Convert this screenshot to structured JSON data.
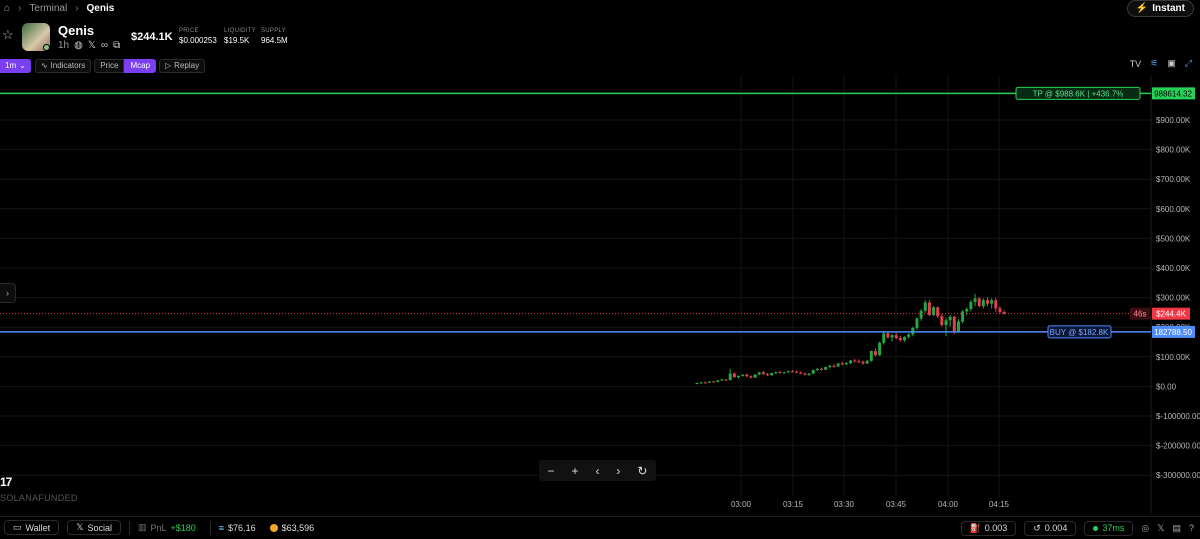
{
  "breadcrumb": {
    "home_icon": "home-icon",
    "items": [
      "Terminal",
      "Qenis"
    ]
  },
  "instant": {
    "label": "Instant",
    "icon": "lightning-icon"
  },
  "token": {
    "name": "Qenis",
    "age": "1h",
    "market_cap": "$244.1K",
    "stats": [
      {
        "label": "PRICE",
        "value": "$0.000253"
      },
      {
        "label": "LIQUIDITY",
        "value": "$19.5K"
      },
      {
        "label": "SUPPLY",
        "value": "964.5M"
      }
    ]
  },
  "toolbar": {
    "timeframe": "1m",
    "indicators": "Indicators",
    "price": "Price",
    "mcap": "Mcap",
    "replay": "Replay"
  },
  "chart_data": {
    "type": "candlestick",
    "price_axis_labels": [
      "$900.00K",
      "$800.00K",
      "$700.00K",
      "$600.00K",
      "$500.00K",
      "$400.00K",
      "$300.00K",
      "$200.00K",
      "$100.00K",
      "$0.00",
      "$-100000.00",
      "$-200000.00",
      "$-300000.00"
    ],
    "time_axis_labels": [
      "03:00",
      "03:15",
      "03:30",
      "03:45",
      "04:00",
      "04:15"
    ],
    "tp_line": {
      "label": "TP @ $988.6K | +436.7%",
      "value": 988614.32,
      "axis_label": "988614.32",
      "color": "#27d158"
    },
    "buy_line": {
      "label": "BUY @ $182.8K",
      "value": 182788.5,
      "axis_label": "182788.50",
      "color": "#4f8cff"
    },
    "current": {
      "countdown": "46s",
      "label": "$244.4K",
      "value": 244400,
      "color": "#f23645"
    },
    "candles_mcap_k": [
      [
        8,
        12,
        6,
        10
      ],
      [
        10,
        14,
        8,
        12
      ],
      [
        12,
        15,
        9,
        11
      ],
      [
        11,
        16,
        10,
        15
      ],
      [
        15,
        18,
        13,
        14
      ],
      [
        14,
        20,
        12,
        19
      ],
      [
        19,
        25,
        17,
        22
      ],
      [
        22,
        24,
        18,
        20
      ],
      [
        20,
        58,
        19,
        42
      ],
      [
        42,
        46,
        28,
        30
      ],
      [
        30,
        36,
        25,
        34
      ],
      [
        34,
        40,
        32,
        38
      ],
      [
        38,
        42,
        30,
        33
      ],
      [
        33,
        36,
        26,
        28
      ],
      [
        28,
        40,
        27,
        39
      ],
      [
        39,
        48,
        36,
        46
      ],
      [
        46,
        50,
        38,
        40
      ],
      [
        40,
        44,
        34,
        36
      ],
      [
        36,
        45,
        35,
        44
      ],
      [
        44,
        50,
        40,
        47
      ],
      [
        47,
        52,
        42,
        44
      ],
      [
        44,
        48,
        41,
        46
      ],
      [
        46,
        52,
        45,
        50
      ],
      [
        50,
        54,
        46,
        48
      ],
      [
        48,
        52,
        44,
        45
      ],
      [
        45,
        50,
        40,
        42
      ],
      [
        42,
        46,
        36,
        38
      ],
      [
        38,
        44,
        34,
        42
      ],
      [
        42,
        56,
        40,
        54
      ],
      [
        54,
        60,
        50,
        58
      ],
      [
        58,
        62,
        52,
        55
      ],
      [
        55,
        66,
        54,
        64
      ],
      [
        64,
        72,
        60,
        68
      ],
      [
        68,
        74,
        62,
        66
      ],
      [
        66,
        78,
        64,
        76
      ],
      [
        76,
        82,
        70,
        74
      ],
      [
        74,
        80,
        70,
        78
      ],
      [
        78,
        88,
        74,
        86
      ],
      [
        86,
        92,
        80,
        84
      ],
      [
        84,
        90,
        78,
        82
      ],
      [
        82,
        86,
        72,
        76
      ],
      [
        76,
        88,
        74,
        85
      ],
      [
        85,
        120,
        82,
        118
      ],
      [
        118,
        128,
        100,
        104
      ],
      [
        104,
        150,
        102,
        146
      ],
      [
        146,
        182,
        140,
        178
      ],
      [
        178,
        184,
        160,
        164
      ],
      [
        164,
        176,
        150,
        172
      ],
      [
        172,
        180,
        158,
        162
      ],
      [
        162,
        170,
        150,
        155
      ],
      [
        155,
        168,
        150,
        166
      ],
      [
        166,
        178,
        160,
        174
      ],
      [
        174,
        200,
        168,
        196
      ],
      [
        196,
        232,
        190,
        228
      ],
      [
        228,
        260,
        220,
        254
      ],
      [
        254,
        290,
        248,
        282
      ],
      [
        282,
        290,
        236,
        240
      ],
      [
        240,
        270,
        236,
        266
      ],
      [
        266,
        268,
        230,
        236
      ],
      [
        236,
        244,
        200,
        206
      ],
      [
        206,
        230,
        168,
        222
      ],
      [
        222,
        240,
        200,
        234
      ],
      [
        234,
        236,
        176,
        182
      ],
      [
        182,
        226,
        180,
        218
      ],
      [
        218,
        256,
        212,
        252
      ],
      [
        252,
        266,
        240,
        260
      ],
      [
        260,
        290,
        252,
        284
      ],
      [
        284,
        312,
        270,
        296
      ],
      [
        296,
        300,
        266,
        270
      ],
      [
        270,
        296,
        262,
        290
      ],
      [
        290,
        300,
        270,
        278
      ],
      [
        278,
        296,
        262,
        290
      ],
      [
        290,
        298,
        250,
        262
      ],
      [
        262,
        270,
        244,
        250
      ],
      [
        250,
        256,
        242,
        244
      ]
    ]
  },
  "zoom_controls": [
    "−",
    "+",
    "‹",
    "›",
    "↻"
  ],
  "tv_logo": "17",
  "watermark": "SOLANAFUNDED",
  "bottombar": {
    "wallet": "Wallet",
    "social": "Social",
    "pnl_label": "PnL",
    "pnl_value": "+$180",
    "sol_balance": "$76.16",
    "coin_balance": "$63,596",
    "fee1": "0.003",
    "fee2": "0.004",
    "ping": "37ms"
  }
}
